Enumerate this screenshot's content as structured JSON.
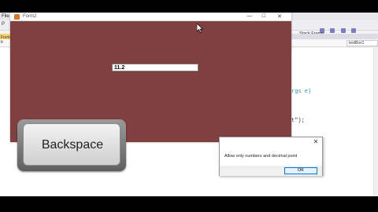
{
  "ide": {
    "menu_label": "File",
    "toolbar_left_label": "P",
    "stack_frame_label": "Stack Frame:",
    "form_tab_label": "Form",
    "nav_left_label": "ti",
    "nav_right_label": "textBox1",
    "code_line_1_keyword": "rgs e)",
    "code_line_2_string": "t\");"
  },
  "form2": {
    "title": "Form2",
    "minimize_glyph": "—",
    "maximize_glyph": "☐",
    "close_glyph": "✕",
    "textbox_value": "11.2",
    "back_color": "#814040"
  },
  "overlay": {
    "backspace_label": "Backspace"
  },
  "message_box": {
    "text": "Allow only numbers and decimal point",
    "ok_label": "OK",
    "close_glyph": "✕"
  }
}
